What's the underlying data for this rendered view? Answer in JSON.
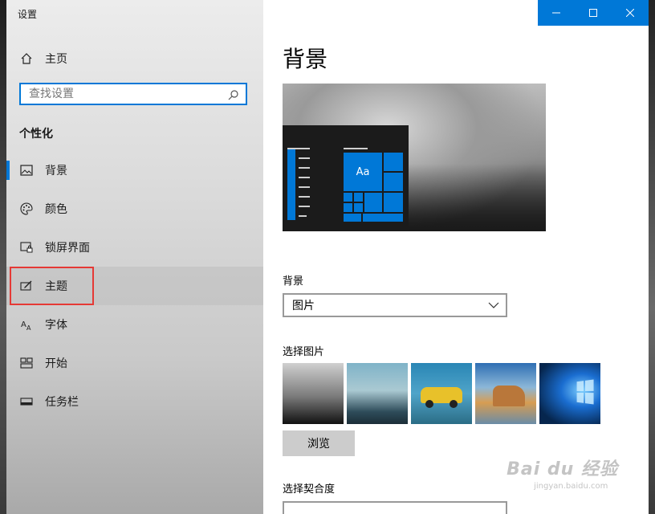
{
  "window": {
    "title": "设置"
  },
  "sidebar": {
    "home_label": "主页",
    "search_placeholder": "查找设置",
    "section_title": "个性化",
    "items": [
      {
        "label": "背景",
        "icon": "picture-icon"
      },
      {
        "label": "颜色",
        "icon": "palette-icon"
      },
      {
        "label": "锁屏界面",
        "icon": "lock-screen-icon"
      },
      {
        "label": "主题",
        "icon": "theme-icon"
      },
      {
        "label": "字体",
        "icon": "font-icon"
      },
      {
        "label": "开始",
        "icon": "start-icon"
      },
      {
        "label": "任务栏",
        "icon": "taskbar-icon"
      }
    ],
    "selected_item": "背景",
    "highlighted_item": "主题"
  },
  "content": {
    "page_title": "背景",
    "preview_tile_text": "Aa",
    "background_label": "背景",
    "background_value": "图片",
    "choose_picture_label": "选择图片",
    "browse_label": "浏览",
    "choose_fit_label": "选择契合度"
  },
  "watermark": {
    "main": "Bai du 经验",
    "sub": "jingyan.baidu.com"
  },
  "colors": {
    "accent": "#0078d7",
    "highlight_box": "#e53935"
  }
}
